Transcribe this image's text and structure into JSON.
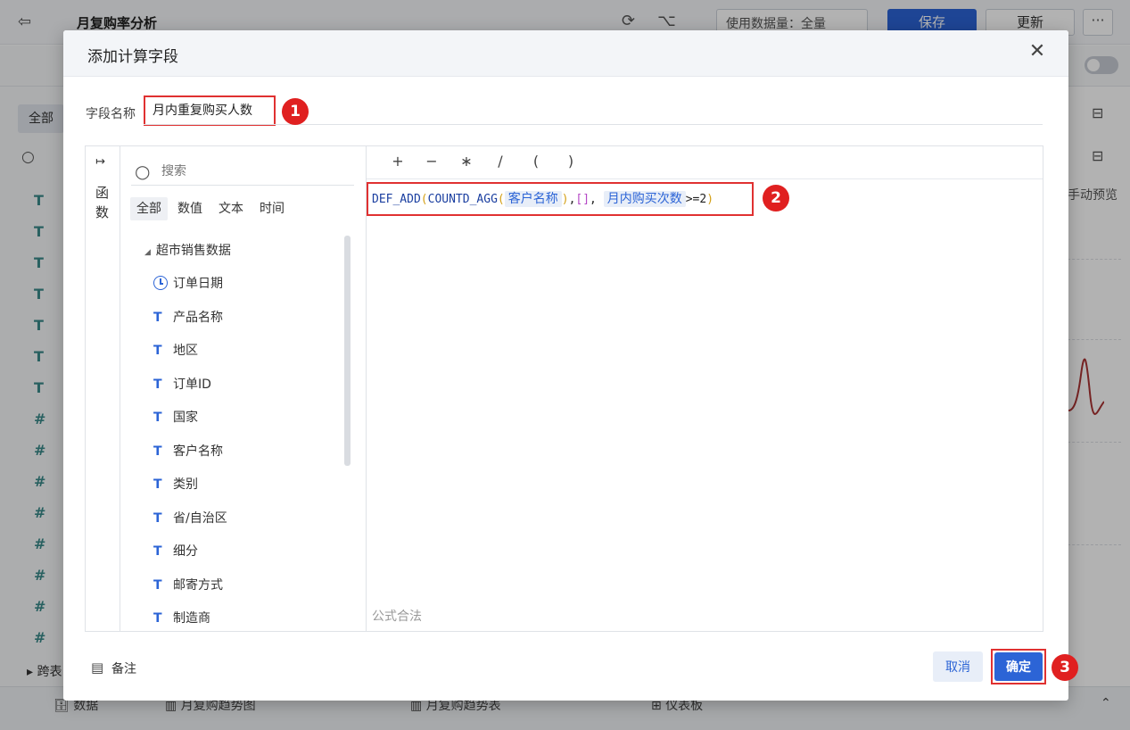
{
  "app": {
    "title": "月复购率分析",
    "data_usage": "使用数据量：全量",
    "save_label": "保存",
    "update_label": "更新",
    "more_label": "···",
    "left_tab_all": "全部",
    "left_search": "搜索",
    "right_preview": "手动预览",
    "bottom_tabs": [
      "数据",
      "月复购趋势图",
      "月复购趋势表",
      "仪表板"
    ],
    "cross_table": "跨表"
  },
  "dialog": {
    "title": "添加计算字段",
    "close_icon": "close-icon",
    "name_label": "字段名称",
    "name_value": "月内重复购买人数",
    "function_label": "函数",
    "search_placeholder": "搜索",
    "field_tabs": [
      "全部",
      "数值",
      "文本",
      "时间"
    ],
    "dataset": "超市销售数据",
    "fields": [
      {
        "name": "订单日期",
        "type": "date"
      },
      {
        "name": "产品名称",
        "type": "text"
      },
      {
        "name": "地区",
        "type": "text"
      },
      {
        "name": "订单ID",
        "type": "text"
      },
      {
        "name": "国家",
        "type": "text"
      },
      {
        "name": "客户名称",
        "type": "text"
      },
      {
        "name": "类别",
        "type": "text"
      },
      {
        "name": "省/自治区",
        "type": "text"
      },
      {
        "name": "细分",
        "type": "text"
      },
      {
        "name": "邮寄方式",
        "type": "text"
      },
      {
        "name": "制造商",
        "type": "text"
      }
    ],
    "operators": [
      "+",
      "−",
      "∗",
      "/",
      "(",
      ")"
    ],
    "formula": {
      "fn1": "DEF_ADD",
      "fn2": "COUNTD_AGG",
      "field1": "客户名称",
      "bracket": "[]",
      "field2": "月内购买次数",
      "tail": ">=2"
    },
    "status": "公式合法",
    "note_label": "备注",
    "cancel_label": "取消",
    "ok_label": "确定"
  },
  "badges": [
    "1",
    "2",
    "3"
  ],
  "colors": {
    "primary": "#2c64d6",
    "highlight": "#e03131",
    "badge": "#e02020"
  }
}
